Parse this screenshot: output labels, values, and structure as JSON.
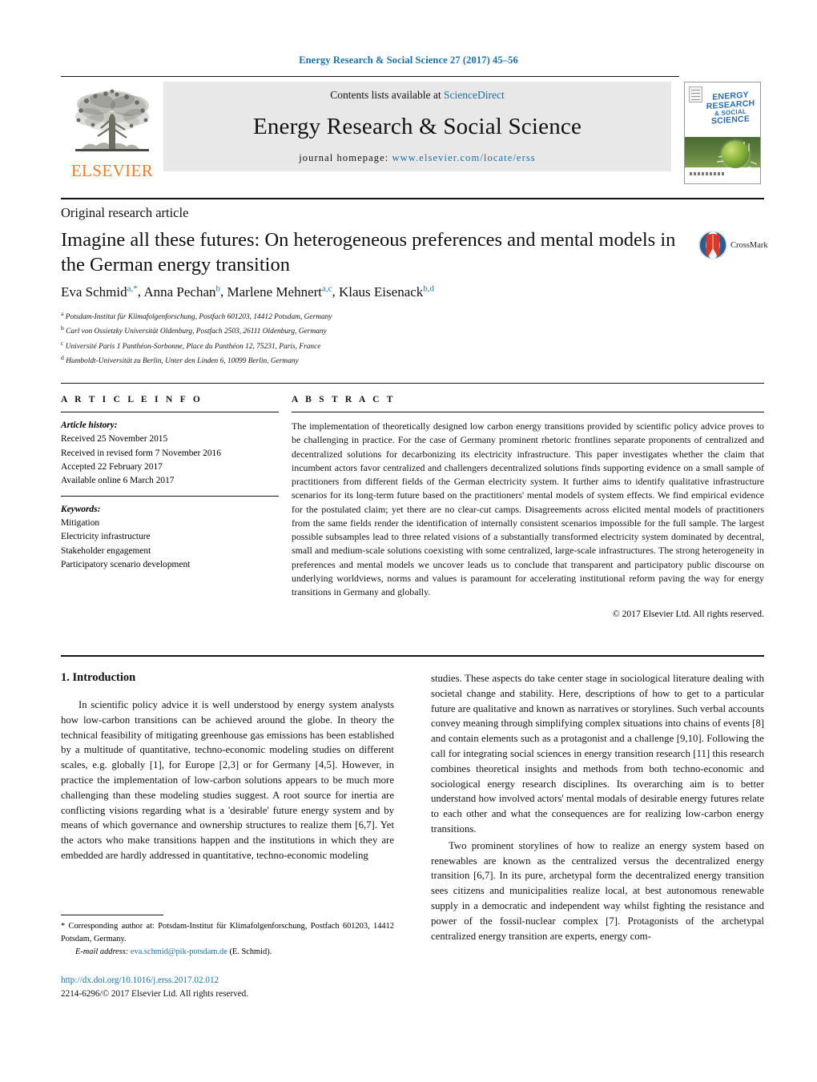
{
  "running_head": "Energy Research & Social Science 27 (2017) 45–56",
  "header": {
    "contents_prefix": "Contents lists available at ",
    "sciencedirect": "ScienceDirect",
    "journal_title": "Energy Research & Social Science",
    "homepage_label": "journal homepage: ",
    "homepage_url": "www.elsevier.com/locate/erss",
    "publisher_wordmark": "ELSEVIER",
    "cover_title_line1": "ENERGY",
    "cover_title_line2": "RESEARCH",
    "cover_title_line3": "& SOCIAL",
    "cover_title_line4": "SCIENCE"
  },
  "article": {
    "type": "Original research article",
    "title": "Imagine all these futures: On heterogeneous preferences and mental models in the German energy transition",
    "crossmark_label": "CrossMark",
    "authors": [
      {
        "name": "Eva Schmid",
        "marks": "a,*"
      },
      {
        "name": "Anna Pechan",
        "marks": "b"
      },
      {
        "name": "Marlene Mehnert",
        "marks": "a,c"
      },
      {
        "name": "Klaus Eisenack",
        "marks": "b,d"
      }
    ],
    "affiliations": [
      {
        "mark": "a",
        "text": "Potsdam-Institut für Klimafolgenforschung, Postfach 601203, 14412 Potsdam, Germany"
      },
      {
        "mark": "b",
        "text": "Carl von Ossietzky Universität Oldenburg, Postfach 2503, 26111 Oldenburg, Germany"
      },
      {
        "mark": "c",
        "text": "Université Paris 1 Panthéon-Sorbonne, Place du Panthéon 12, 75231, Paris, France"
      },
      {
        "mark": "d",
        "text": "Humboldt-Universität zu Berlin, Unter den Linden 6, 10099 Berlin, Germany"
      }
    ]
  },
  "article_info": {
    "heading": "A R T I C L E   I N F O",
    "history_label": "Article history:",
    "history": [
      "Received 25 November 2015",
      "Received in revised form 7 November 2016",
      "Accepted 22 February 2017",
      "Available online 6 March 2017"
    ],
    "keywords_label": "Keywords:",
    "keywords": [
      "Mitigation",
      "Electricity infrastructure",
      "Stakeholder engagement",
      "Participatory scenario development"
    ]
  },
  "abstract": {
    "heading": "A B S T R A C T",
    "text": "The implementation of theoretically designed low carbon energy transitions provided by scientific policy advice proves to be challenging in practice. For the case of Germany prominent rhetoric frontlines separate proponents of centralized and decentralized solutions for decarbonizing its electricity infrastructure. This paper investigates whether the claim that incumbent actors favor centralized and challengers decentralized solutions finds supporting evidence on a small sample of practitioners from different fields of the German electricity system. It further aims to identify qualitative infrastructure scenarios for its long-term future based on the practitioners' mental models of system effects. We find empirical evidence for the postulated claim; yet there are no clear-cut camps. Disagreements across elicited mental models of practitioners from the same fields render the identification of internally consistent scenarios impossible for the full sample. The largest possible subsamples lead to three related visions of a substantially transformed electricity system dominated by decentral, small and medium-scale solutions coexisting with some centralized, large-scale infrastructures. The strong heterogeneity in preferences and mental models we uncover leads us to conclude that transparent and participatory public discourse on underlying worldviews, norms and values is paramount for accelerating institutional reform paving the way for energy transitions in Germany and globally.",
    "copyright": "© 2017 Elsevier Ltd. All rights reserved."
  },
  "body": {
    "section_number_title": "1.  Introduction",
    "left_paragraphs": [
      "In scientific policy advice it is well understood by energy system analysts how low-carbon transitions can be achieved around the globe. In theory the technical feasibility of mitigating greenhouse gas emissions has been established by a multitude of quantitative, techno-economic modeling studies on different scales, e.g. globally [1], for Europe [2,3] or for Germany [4,5]. However, in practice the implementation of low-carbon solutions appears to be much more challenging than these modeling studies suggest. A root source for inertia are conflicting visions regarding what is a 'desirable' future energy system and by means of which governance and ownership structures to realize them [6,7]. Yet the actors who make transitions happen and the institutions in which they are embedded are hardly addressed in quantitative, techno-economic modeling"
    ],
    "right_paragraphs": [
      "studies. These aspects do take center stage in sociological literature dealing with societal change and stability. Here, descriptions of how to get to a particular future are qualitative and known as narratives or storylines. Such verbal accounts convey meaning through simplifying complex situations into chains of events [8] and contain elements such as a protagonist and a challenge [9,10]. Following the call for integrating social sciences in energy transition research [11] this research combines theoretical insights and methods from both techno-economic and sociological energy research disciplines. Its overarching aim is to better understand how involved actors' mental modals of desirable energy futures relate to each other and what the consequences are for realizing low-carbon energy transitions.",
      "Two prominent storylines of how to realize an energy system based on renewables are known as the centralized versus the decentralized energy transition [6,7]. In its pure, archetypal form the decentralized energy transition sees citizens and municipalities realize local, at best autonomous renewable supply in a democratic and independent way whilst fighting the resistance and power of the fossil-nuclear complex [7]. Protagonists of the archetypal centralized energy transition are experts, energy com-"
    ]
  },
  "footnotes": {
    "corresponding": "* Corresponding author at: Potsdam-Institut für Klimafolgenforschung, Postfach 601203, 14412 Potsdam, Germany.",
    "email_label": "E-mail address:",
    "email": "eva.schmid@pik-potsdam.de",
    "email_suffix": "(E. Schmid).",
    "doi": "http://dx.doi.org/10.1016/j.erss.2017.02.012",
    "issn_line": "2214-6296/© 2017 Elsevier Ltd. All rights reserved."
  },
  "colors": {
    "link_blue": "#1a6fa8",
    "elsevier_orange": "#F47B20",
    "banner_grey": "#e8e8e8",
    "crossmark_red": "#d8392b"
  }
}
